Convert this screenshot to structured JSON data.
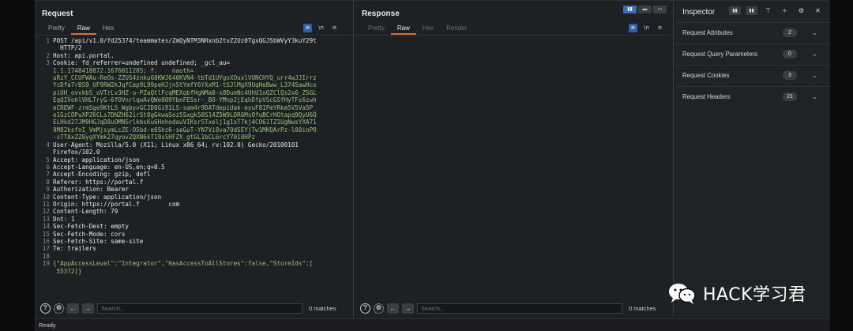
{
  "request": {
    "title": "Request",
    "tabs": [
      "Pretty",
      "Raw",
      "Hex"
    ],
    "active_tab": "Raw",
    "lines": [
      {
        "n": "1",
        "t": "POST /api/v1.0/fd25374/teammates/ZmQyNTM3NHxnb2tvZ2Uz0TgxQGJSbWVyY3kuY29t",
        "cls": "hdr"
      },
      {
        "n": "",
        "t": "  HTTP/2",
        "cls": "hdr"
      },
      {
        "n": "2",
        "t": "Host: api.portal.",
        "cls": "hdr"
      },
      {
        "n": "3",
        "t": "Cookie: fd_referrer=undefined undefined; _gcl_au=",
        "cls": "hdr"
      },
      {
        "n": "",
        "t": "1.1.1748418872.1676011205; f.    nauth=",
        "cls": "gr"
      },
      {
        "n": "",
        "t": "uRzY_CCUFWAu-ReOs-ZZUS4znku68KWJ640KVN4-tbTd1UYgsXOuxlVUNCHYQ_urr4wJJIrrz",
        "cls": "gr"
      },
      {
        "n": "",
        "t": "YcDfe7rBS9_UF9RW2kJqfCep9L99peHJjnStYmfY6YXxM1-tSJlMgX9UqHeBww_L374SawHco",
        "cls": "gr"
      },
      {
        "n": "",
        "t": "piUH_ovvkbS_oVTrLv3HZ-u-PZaQtlFcqMEXqbfHgNMa0-s8DueNc4UhU1oQZClQs2x6_ZSGL",
        "cls": "gr"
      },
      {
        "n": "",
        "t": "EqQIVohlVHLTryG-6fOVnrlqwAvQWe009YbnFESsr-_BO-YMnp2jEqhDfpVScGSfHyTFs6zwh",
        "cls": "gr"
      },
      {
        "n": "",
        "t": "eCREWF-zrmSge9KtLS_WgbyvGCJD0Gi91LS-sam4r9DATdepiUak-eyuF8IPmYRkm5V5Va5P_",
        "cls": "gr"
      },
      {
        "n": "",
        "t": "e1GzCOPuXPZ6CLs7DNZH62irSt8gGkwaSoz5Sxgk50S14Z5W9LDR6MsOfuBCrHOtapq9QyU6Q",
        "cls": "gr"
      },
      {
        "n": "",
        "t": "ELHkd27JM9HGJqD8uOMNSrlkbsKu6HnhodauVIKsr5Txelj1g1sT7kj4CO61TZ1UgNwsYXA71",
        "cls": "gr"
      },
      {
        "n": "",
        "t": "9M82ksfnI_VmMjsymLcZE-O5bd-e6Shz6-seGuT-YN7Vi8va70dSEYjTw1MKQArPz-l00inPO",
        "cls": "gr"
      },
      {
        "n": "",
        "t": "-sTTAxZZ8ygXYmk27qyovZQXN6kT19sSHFZX_gtGL1bCL6rcY7010HPz",
        "cls": "gr"
      },
      {
        "n": "4",
        "t": "User-Agent: Mozilla/5.0 (X11; Linux x86_64; rv:102.0) Gecko/20100101",
        "cls": "hdr"
      },
      {
        "n": "",
        "t": "Firefox/102.0",
        "cls": "hdr"
      },
      {
        "n": "5",
        "t": "Accept: application/json",
        "cls": "hdr"
      },
      {
        "n": "6",
        "t": "Accept-Language: en-US,en;q=0.5",
        "cls": "hdr"
      },
      {
        "n": "7",
        "t": "Accept-Encoding: gzip, defl",
        "cls": "hdr"
      },
      {
        "n": "8",
        "t": "Referer: https://portal.f",
        "cls": "hdr"
      },
      {
        "n": "9",
        "t": "Authorization: Bearer",
        "cls": "hdr"
      },
      {
        "n": "10",
        "t": "Content-Type: application/json",
        "cls": "hdr"
      },
      {
        "n": "11",
        "t": "Origin: https://portal.f        com",
        "cls": "hdr"
      },
      {
        "n": "12",
        "t": "Content-Length: 79",
        "cls": "hdr"
      },
      {
        "n": "13",
        "t": "Dnt: 1",
        "cls": "hdr"
      },
      {
        "n": "14",
        "t": "Sec-Fetch-Dest: empty",
        "cls": "hdr"
      },
      {
        "n": "15",
        "t": "Sec-Fetch-Mode: cors",
        "cls": "hdr"
      },
      {
        "n": "16",
        "t": "Sec-Fetch-Site: same-site",
        "cls": "hdr"
      },
      {
        "n": "17",
        "t": "Te: trailers",
        "cls": "hdr"
      },
      {
        "n": "18",
        "t": "",
        "cls": "hdr"
      },
      {
        "n": "19",
        "t": "{\"AppAccessLevel\":\"Integrator\",\"HasAccessToAllStores\":false,\"StoreIds\":[",
        "cls": "gr"
      },
      {
        "n": "",
        "t": " 55372]}",
        "cls": "gr"
      }
    ],
    "search_placeholder": "Search...",
    "matches": "0 matches"
  },
  "response": {
    "title": "Response",
    "tabs": [
      "Pretty",
      "Raw",
      "Hex",
      "Render"
    ],
    "active_tab": "Raw",
    "search_placeholder": "Search...",
    "matches": "0 matches"
  },
  "inspector": {
    "title": "Inspector",
    "rows": [
      {
        "label": "Request Attributes",
        "count": "2"
      },
      {
        "label": "Request Query Parameters",
        "count": "0"
      },
      {
        "label": "Request Cookies",
        "count": "3"
      },
      {
        "label": "Request Headers",
        "count": "21"
      }
    ]
  },
  "status": "Ready",
  "watermark": "HACK学习君",
  "icons": {
    "help": "help-icon",
    "settings": "gear-icon",
    "back": "arrow-left-icon",
    "forward": "arrow-right-icon",
    "wrap": "wrap-icon",
    "newline": "newline-icon",
    "menu": "menu-icon",
    "close": "close-icon"
  },
  "colors": {
    "accent": "#e06c2a",
    "toggle_blue": "#2e62a8",
    "code_green": "#9bc07a"
  }
}
